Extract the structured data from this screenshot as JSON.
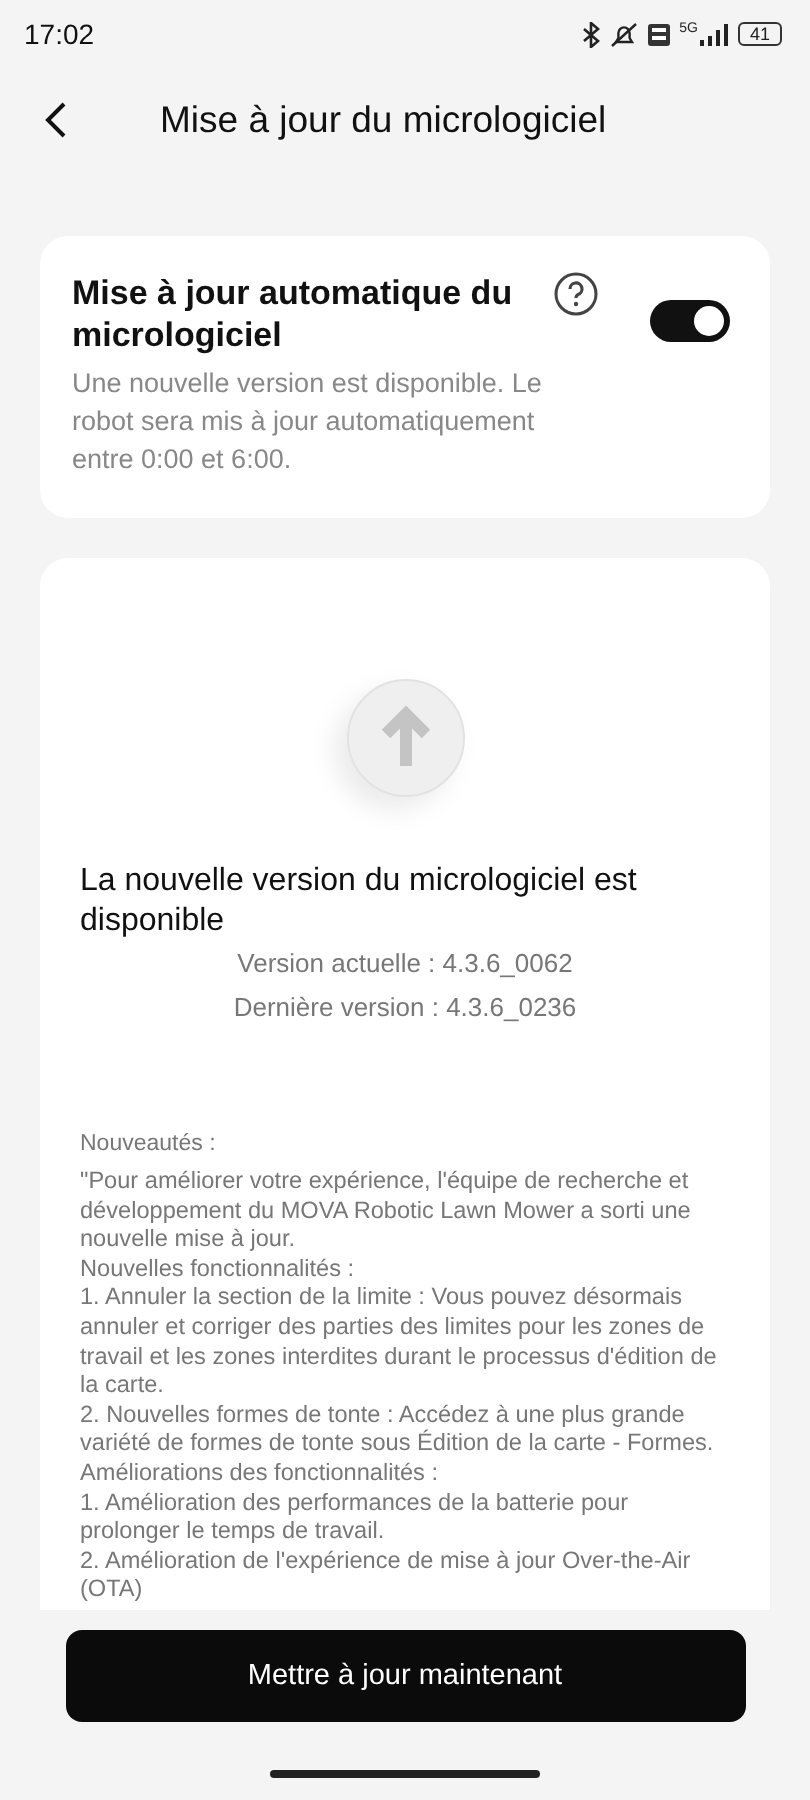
{
  "status_bar": {
    "time": "17:02",
    "network": "5G",
    "battery": "41"
  },
  "header": {
    "title": "Mise à jour du micrologiciel"
  },
  "auto_update": {
    "title": "Mise à jour automatique du micrologiciel",
    "on": true,
    "description": "Une nouvelle version est disponible. Le robot sera mis à jour automatiquement entre 0:00 et 6:00."
  },
  "update": {
    "headline": "La nouvelle version du micrologiciel est disponible",
    "current_version": "Version actuelle : 4.3.6_0062",
    "latest_version": "Dernière version : 4.3.6_0236",
    "notes_title": "Nouveautés :",
    "notes": [
      "\"Pour améliorer votre expérience, l'équipe de recherche et développement du MOVA Robotic Lawn Mower a sorti une nouvelle mise à jour.",
      "Nouvelles fonctionnalités :",
      "1. Annuler la section de la limite : Vous pouvez désormais annuler et corriger des parties des limites pour les zones de travail et les zones interdites durant le processus d'édition de la carte.",
      "2. Nouvelles formes de tonte : Accédez à une plus grande variété de formes de tonte sous Édition de la carte - Formes.",
      "Améliorations des fonctionnalités :",
      "1. Amélioration des performances de la batterie pour prolonger le temps de travail.",
      "2. Amélioration de l'expérience de mise à jour Over-the-Air (OTA)"
    ]
  },
  "button": {
    "label": "Mettre à jour maintenant"
  }
}
